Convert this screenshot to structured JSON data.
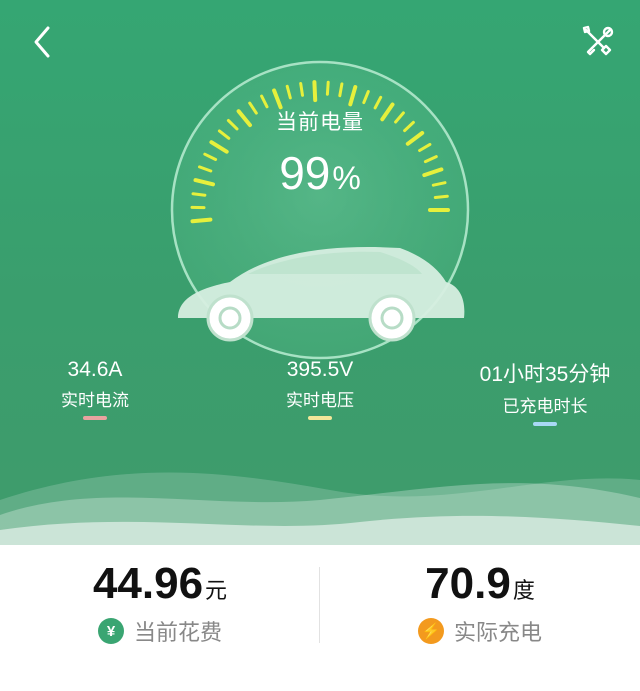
{
  "header": {
    "back_icon": "chevron-left-icon",
    "tools_icon": "tools-icon"
  },
  "gauge": {
    "title": "当前电量",
    "value": "99",
    "unit": "%",
    "level_fraction": 0.99
  },
  "stats": {
    "current": {
      "value": "34.6A",
      "label": "实时电流",
      "accent": "#e8a3a0"
    },
    "voltage": {
      "value": "395.5V",
      "label": "实时电压",
      "accent": "#f2e79a"
    },
    "duration": {
      "value": "01小时35分钟",
      "label": "已充电时长",
      "accent": "#a9d8f5"
    }
  },
  "bottom": {
    "cost": {
      "value": "44.96",
      "unit": "元",
      "label": "当前花费",
      "icon_glyph": "¥",
      "icon": "yen-icon"
    },
    "energy": {
      "value": "70.9",
      "unit": "度",
      "label": "实际充电",
      "icon_glyph": "⚡",
      "icon": "lightning-icon"
    }
  },
  "colors": {
    "background_green": "#3a9e6d",
    "tick_yellow": "#e6f03c",
    "accent_orange": "#f39a1e"
  }
}
